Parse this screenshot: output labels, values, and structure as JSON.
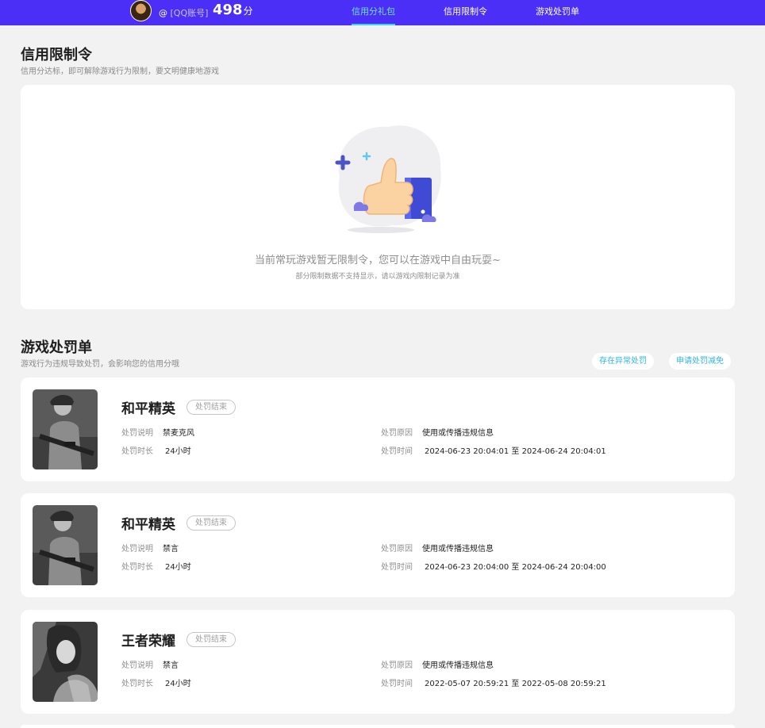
{
  "header": {
    "account_at": "@",
    "account_label": "[QQ账号]",
    "score": "498",
    "score_unit": "分",
    "tabs": [
      {
        "label": "信用分礼包",
        "active": true
      },
      {
        "label": "信用限制令",
        "active": false
      },
      {
        "label": "游戏处罚单",
        "active": false
      }
    ],
    "accent": "#4b2ff7"
  },
  "restriction": {
    "title": "信用限制令",
    "subtitle": "信用分达标，即可解除游戏行为限制，要文明健康地游戏",
    "empty_message": "当前常玩游戏暂无限制令，您可以在游戏中自由玩耍~",
    "empty_note": "部分限制数据不支持显示，请以游戏内限制记录为准"
  },
  "penalties": {
    "title": "游戏处罚单",
    "subtitle": "游戏行为违规导致处罚，会影响您的信用分哦",
    "abnormal_button": "存在异常处罚",
    "appeal_button": "申请处罚减免",
    "labels": {
      "desc": "处罚说明",
      "duration": "处罚时长",
      "reason": "处罚原因",
      "time": "处罚时间"
    },
    "items": [
      {
        "game": "和平精英",
        "status": "处罚结束",
        "desc": "禁麦克风",
        "duration": "24小时",
        "reason": "使用或传播违规信息",
        "time": "2024-06-23 20:04:01 至 2024-06-24 20:04:01"
      },
      {
        "game": "和平精英",
        "status": "处罚结束",
        "desc": "禁言",
        "duration": "24小时",
        "reason": "使用或传播违规信息",
        "time": "2024-06-23 20:04:00 至 2024-06-24 20:04:00"
      },
      {
        "game": "王者荣耀",
        "status": "处罚结束",
        "desc": "禁言",
        "duration": "24小时",
        "reason": "使用或传播违规信息",
        "time": "2022-05-07 20:59:21 至 2022-05-08 20:59:21"
      }
    ]
  }
}
